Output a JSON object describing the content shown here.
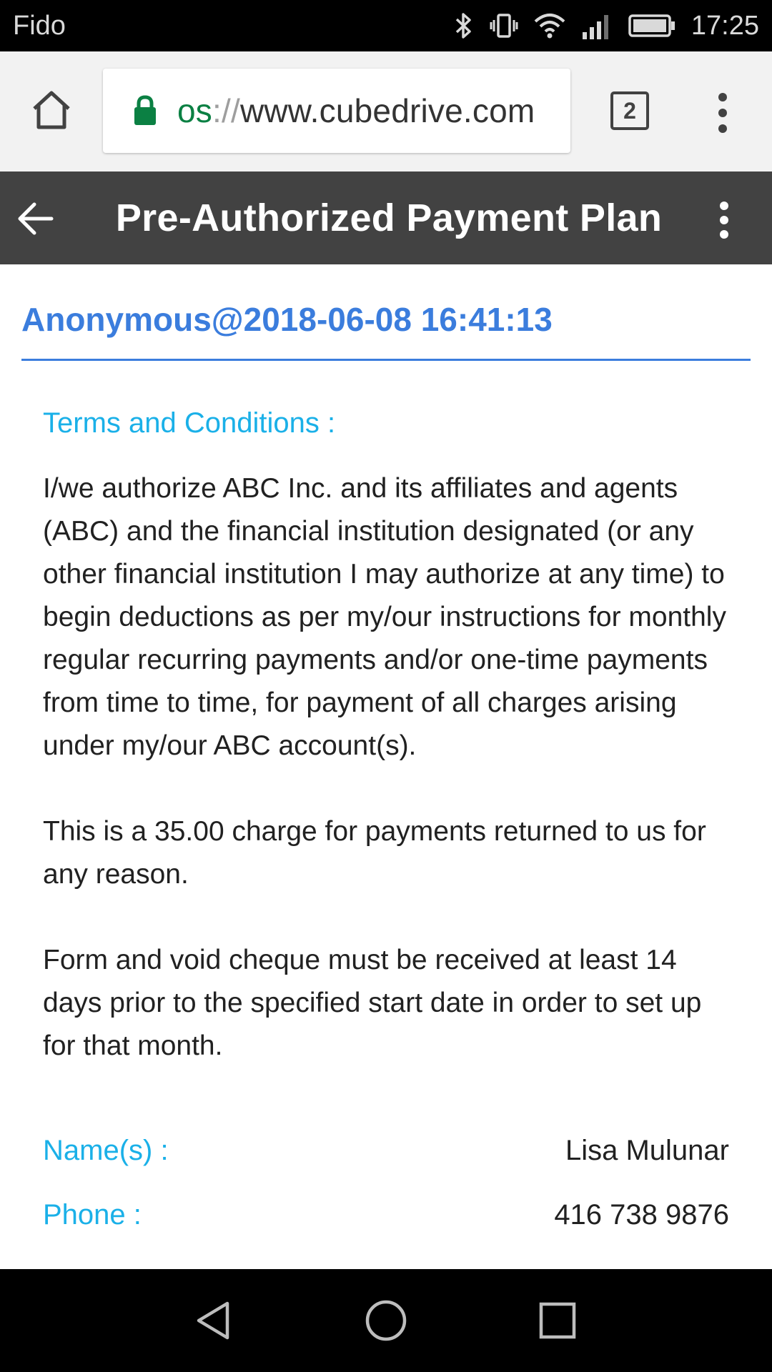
{
  "status_bar": {
    "carrier": "Fido",
    "time": "17:25",
    "icons": [
      "bluetooth-icon",
      "vibrate-icon",
      "wifi-icon",
      "signal-icon",
      "battery-icon"
    ]
  },
  "browser": {
    "url_scheme": "os",
    "url_separator": "://",
    "url_host": "www.cubedrive.com",
    "tab_count": "2",
    "icons": [
      "home-icon",
      "lock-icon",
      "overflow-menu-icon"
    ]
  },
  "app_header": {
    "title": "Pre-Authorized Payment Plan",
    "icons": [
      "back-arrow-icon",
      "overflow-menu-icon"
    ]
  },
  "record": {
    "header": "Anonymous@2018-06-08 16:41:13",
    "terms_label": "Terms and Conditions :",
    "terms_paragraphs": [
      "I/we authorize ABC Inc. and its affiliates and agents (ABC) and the financial institution designated (or any other financial institution I may authorize at any time) to begin deductions as per my/our instructions for monthly regular recurring payments and/or one-time payments from time to time, for payment of all charges arising under my/our ABC account(s).",
      "This is a 35.00 charge for payments returned to us for any reason.",
      "Form and void cheque must be received at least 14 days prior to the specified start date in order to set up for that month."
    ],
    "fields": [
      {
        "label": "Name(s) :",
        "value": "Lisa Mulunar"
      },
      {
        "label": "Phone :",
        "value": "416 738 9876"
      }
    ]
  },
  "nav_bar": {
    "icons": [
      "nav-back-icon",
      "nav-home-icon",
      "nav-recents-icon"
    ]
  },
  "colors": {
    "accent_blue": "#3b7ddd",
    "label_cyan": "#1ab0e8",
    "header_gray": "#424242",
    "secure_green": "#0b8043"
  }
}
